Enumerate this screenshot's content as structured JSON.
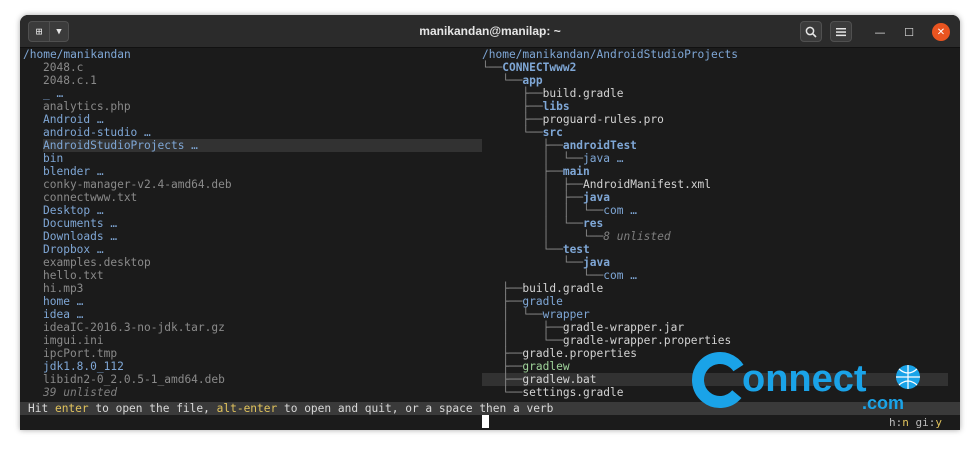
{
  "window": {
    "title": "manikandan@manilap: ~",
    "newtab_icon": "new-tab-icon",
    "menu_icon": "chevron-down-icon"
  },
  "left_panel": {
    "path": "/home/manikandan",
    "items": [
      {
        "name": "2048.c",
        "kind": "file"
      },
      {
        "name": "2048.c.1",
        "kind": "file"
      },
      {
        "name": "_ …",
        "kind": "dir"
      },
      {
        "name": "analytics.php",
        "kind": "file"
      },
      {
        "name": "Android …",
        "kind": "dir"
      },
      {
        "name": "android-studio …",
        "kind": "dir"
      },
      {
        "name": "AndroidStudioProjects …",
        "kind": "dir",
        "selected": true
      },
      {
        "name": "bin",
        "kind": "dir"
      },
      {
        "name": "blender …",
        "kind": "dir"
      },
      {
        "name": "conky-manager-v2.4-amd64.deb",
        "kind": "file"
      },
      {
        "name": "connectwww.txt",
        "kind": "file"
      },
      {
        "name": "Desktop …",
        "kind": "dir"
      },
      {
        "name": "Documents …",
        "kind": "dir"
      },
      {
        "name": "Downloads …",
        "kind": "dir"
      },
      {
        "name": "Dropbox …",
        "kind": "dir"
      },
      {
        "name": "examples.desktop",
        "kind": "file"
      },
      {
        "name": "hello.txt",
        "kind": "file"
      },
      {
        "name": "hi.mp3",
        "kind": "file"
      },
      {
        "name": "home …",
        "kind": "dir"
      },
      {
        "name": "idea …",
        "kind": "dir"
      },
      {
        "name": "ideaIC-2016.3-no-jdk.tar.gz",
        "kind": "file"
      },
      {
        "name": "imgui.ini",
        "kind": "file"
      },
      {
        "name": "ipcPort.tmp",
        "kind": "file"
      },
      {
        "name": "jdk1.8.0_112",
        "kind": "dir"
      },
      {
        "name": "libidn2-0_2.0.5-1_amd64.deb",
        "kind": "file"
      },
      {
        "name": "39 unlisted",
        "kind": "unlisted"
      }
    ]
  },
  "right_panel": {
    "path": "/home/manikandan/AndroidStudioProjects",
    "tree": [
      {
        "prefix": "└──",
        "name": "CONNECTwww2",
        "kind": "bolddir"
      },
      {
        "prefix": "   └──",
        "name": "app",
        "kind": "bolddir"
      },
      {
        "prefix": "      ├──",
        "name": "build.gradle",
        "kind": "file"
      },
      {
        "prefix": "      ├──",
        "name": "libs",
        "kind": "bolddir"
      },
      {
        "prefix": "      ├──",
        "name": "proguard-rules.pro",
        "kind": "file"
      },
      {
        "prefix": "      └──",
        "name": "src",
        "kind": "bolddir"
      },
      {
        "prefix": "         ├──",
        "name": "androidTest",
        "kind": "bolddir"
      },
      {
        "prefix": "         │  └──",
        "name": "java …",
        "kind": "dir"
      },
      {
        "prefix": "         ├──",
        "name": "main",
        "kind": "bolddir"
      },
      {
        "prefix": "         │  ├──",
        "name": "AndroidManifest.xml",
        "kind": "file"
      },
      {
        "prefix": "         │  ├──",
        "name": "java",
        "kind": "bolddir"
      },
      {
        "prefix": "         │  │  └──",
        "name": "com …",
        "kind": "dir"
      },
      {
        "prefix": "         │  └──",
        "name": "res",
        "kind": "bolddir"
      },
      {
        "prefix": "         │     └──",
        "name": "8 unlisted",
        "kind": "unlisted"
      },
      {
        "prefix": "         └──",
        "name": "test",
        "kind": "bolddir"
      },
      {
        "prefix": "            └──",
        "name": "java",
        "kind": "bolddir"
      },
      {
        "prefix": "               └──",
        "name": "com …",
        "kind": "dir"
      },
      {
        "prefix": "   ├──",
        "name": "build.gradle",
        "kind": "file"
      },
      {
        "prefix": "   ├──",
        "name": "gradle",
        "kind": "dir"
      },
      {
        "prefix": "   │  └──",
        "name": "wrapper",
        "kind": "dir"
      },
      {
        "prefix": "   │     ├──",
        "name": "gradle-wrapper.jar",
        "kind": "file"
      },
      {
        "prefix": "   │     └──",
        "name": "gradle-wrapper.properties",
        "kind": "file"
      },
      {
        "prefix": "   ├──",
        "name": "gradle.properties",
        "kind": "file"
      },
      {
        "prefix": "   ├──",
        "name": "gradlew",
        "kind": "green"
      },
      {
        "prefix": "   ├──",
        "name": "gradlew.bat",
        "kind": "file",
        "selected": true
      },
      {
        "prefix": "   └──",
        "name": "settings.gradle",
        "kind": "file"
      }
    ]
  },
  "status": {
    "p1": "Hit ",
    "k1": "enter",
    "p2": " to open the file, ",
    "k2": "alt-enter",
    "p3": " to open and quit, or a space then a verb"
  },
  "hints": {
    "h_label": "h:",
    "h_value": "n",
    "gi_label": "gi:",
    "gi_value": "y"
  },
  "watermark": {
    "brand": "onnect",
    "suffix": ".com"
  },
  "colors": {
    "dir": "#7fa7d6",
    "keyword": "#e1c35c",
    "close": "#e95420",
    "watermark": "#1aa3e8"
  }
}
